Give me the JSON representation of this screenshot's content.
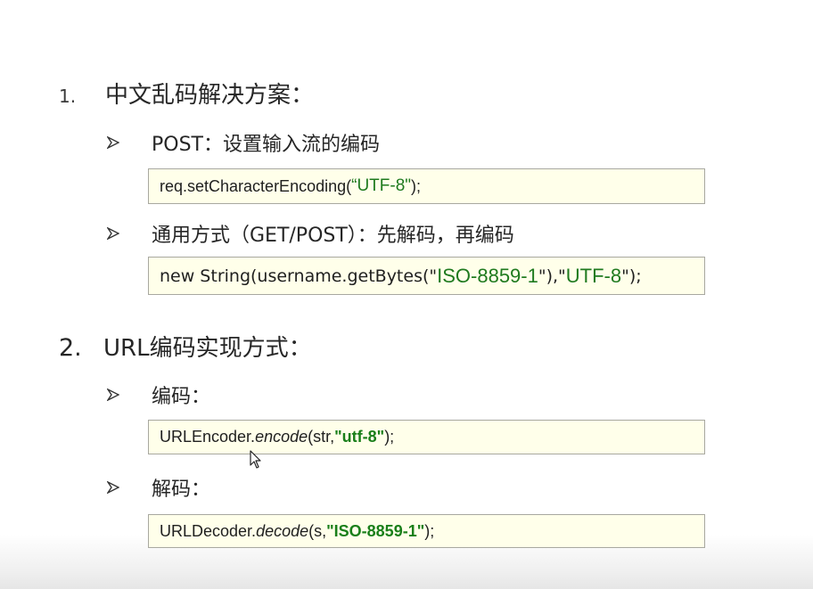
{
  "section1": {
    "number": "1.",
    "title": "中文乱码解决方案："
  },
  "bullet_post": {
    "icon": "arrow-bullet-icon",
    "label": "POST：设置输入流的编码"
  },
  "code_post": {
    "prefix": "req.setCharacterEncoding(",
    "string": "“UTF-8\"",
    "suffix": ");"
  },
  "bullet_general": {
    "icon": "arrow-bullet-icon",
    "label": "通用方式（GET/POST）：先解码，再编码"
  },
  "code_general": {
    "prefix": "new String(username.getBytes(\"",
    "string1": "ISO-8859-1",
    "middle": "\"),\"",
    "string2": "UTF-8",
    "suffix": "\");"
  },
  "section2": {
    "number": "2.",
    "title": "URL编码实现方式："
  },
  "bullet_encode": {
    "icon": "arrow-bullet-icon",
    "label": "编码："
  },
  "code_encode": {
    "prefix": "URLEncoder.",
    "method": "encode",
    "args": "(str, ",
    "string": "\"utf-8\"",
    "suffix": ");"
  },
  "bullet_decode": {
    "icon": "arrow-bullet-icon",
    "label": "解码："
  },
  "code_decode": {
    "prefix": "URLDecoder.",
    "method": "decode",
    "args": "(s, ",
    "string": "\"ISO-8859-1\"",
    "suffix": ");"
  },
  "colors": {
    "code_background": "#ffffea",
    "string_green": "#1f7a1f"
  }
}
